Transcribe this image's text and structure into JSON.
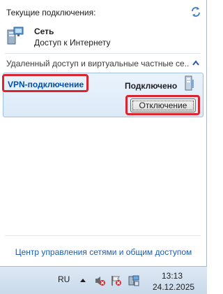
{
  "flyout": {
    "header": "Текущие подключения:",
    "network": {
      "name": "Сеть",
      "status": "Доступ к Интернету"
    },
    "section_title": "Удаленный доступ и виртуальные частные се...",
    "vpn": {
      "name": "VPN-подключение",
      "status": "Подключено",
      "disconnect_label": "Отключение"
    },
    "footer_link": "Центр управления сетями и общим доступом"
  },
  "taskbar": {
    "language": "RU",
    "time": "13:13",
    "date": "24.12.2025"
  },
  "icons": {
    "refresh": "refresh-icon",
    "network": "network-computer-icon",
    "collapse": "chevron-up-icon",
    "vpn": "vpn-connection-icon",
    "volume": "speaker-muted-icon",
    "flag": "action-center-alert-icon",
    "net_tray": "network-tray-icon"
  },
  "colors": {
    "accent": "#0050b0",
    "highlight": "#d8262e",
    "link": "#1a5db2"
  }
}
